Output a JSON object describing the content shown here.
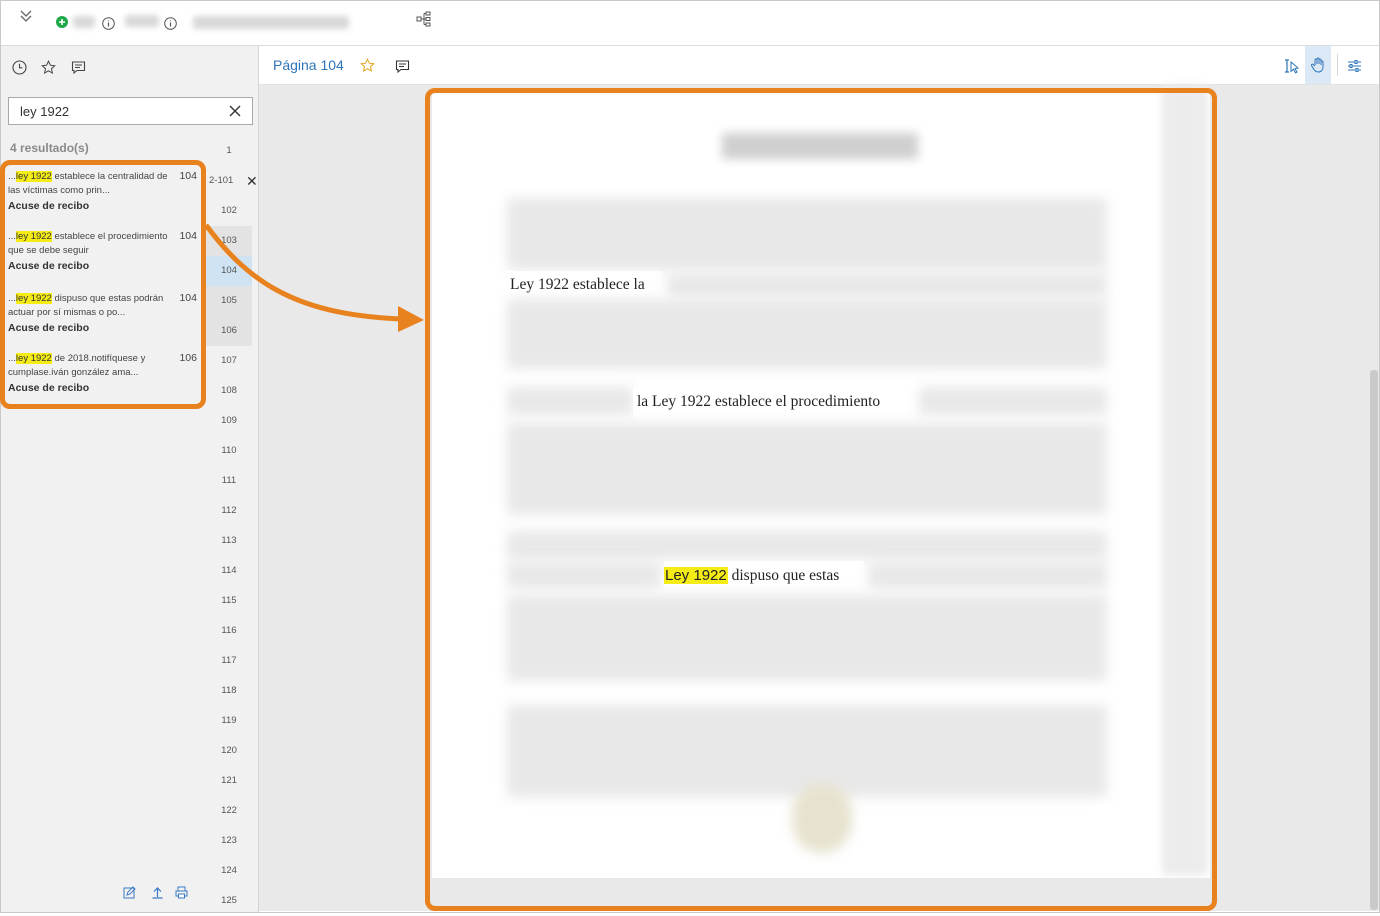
{
  "topbar": {
    "collapse_icon": "double-chevron-down-icon",
    "add_icon": "plus-circle-icon",
    "info_icon": "info-icon",
    "tree_icon": "tree-structure-icon"
  },
  "sidebar": {
    "toolbar_icons": [
      "clock-icon",
      "star-icon",
      "comment-icon"
    ],
    "search": {
      "value": "ley 1922",
      "clear_icon": "close-icon"
    },
    "result_count": "4 resultado(s)",
    "results": [
      {
        "prefix": "...",
        "match": "ley 1922",
        "snippet": " establece la centralidad de las víctimas como prin...",
        "page": "104",
        "document": "Acuse de recibo"
      },
      {
        "prefix": "...",
        "match": "ley 1922",
        "snippet": " establece el procedimiento que se debe seguir",
        "page": "104",
        "document": "Acuse de recibo"
      },
      {
        "prefix": "...",
        "match": "ley 1922",
        "snippet": " dispuso que estas podrán actuar por sí mismas o po...",
        "page": "104",
        "document": "Acuse de recibo"
      },
      {
        "prefix": "...",
        "match": "ley 1922",
        "snippet": " de 2018.notifíquese y cumplase.iván gonzález ama...",
        "page": "106",
        "document": "Acuse de recibo"
      }
    ],
    "pages": [
      "1",
      "2-101",
      "102",
      "103",
      "104",
      "105",
      "106",
      "107",
      "108",
      "109",
      "110",
      "111",
      "112",
      "113",
      "114",
      "115",
      "116",
      "117",
      "118",
      "119",
      "120",
      "121",
      "122",
      "123",
      "124",
      "125"
    ],
    "bottom_icons": [
      "edit-icon",
      "upload-icon",
      "print-icon"
    ]
  },
  "viewer": {
    "page_label": "Página 104",
    "toolbar_icons": [
      "star-icon",
      "comment-icon",
      "text-select-icon",
      "hand-pan-icon",
      "settings-sliders-icon"
    ],
    "lines": [
      {
        "text": "Ley 1922 establece la"
      },
      {
        "text": "la Ley 1922 establece el procedimiento"
      },
      {
        "match": "Ley 1922",
        "text": " dispuso que estas"
      }
    ]
  },
  "annotation_color": "#e8821e",
  "highlight_color": "#f5ec15",
  "accent_color": "#2d74b8"
}
